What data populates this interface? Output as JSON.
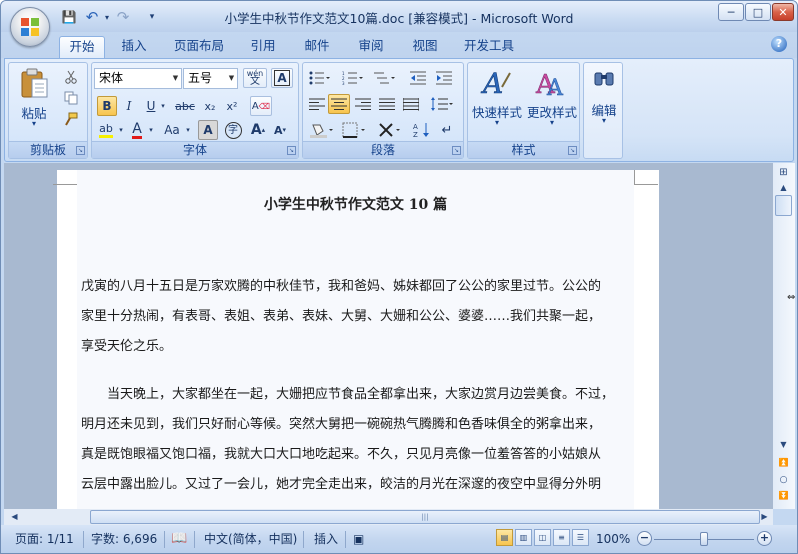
{
  "window": {
    "title": "小学生中秋节作文范文10篇.doc [兼容模式] - Microsoft Word",
    "minimize": "─",
    "maximize": "□",
    "close": "✕"
  },
  "quick_access": {
    "save": "💾",
    "undo": "↶",
    "redo": "↷",
    "customize": "▾"
  },
  "tabs": [
    "开始",
    "插入",
    "页面布局",
    "引用",
    "邮件",
    "审阅",
    "视图",
    "开发工具"
  ],
  "help_label": "?",
  "ribbon": {
    "clipboard": {
      "label": "剪贴板",
      "paste": "粘贴",
      "paste_arrow": "▾"
    },
    "font": {
      "label": "字体",
      "font_name": "宋体",
      "font_size": "五号",
      "bold": "B",
      "italic": "I",
      "underline": "U",
      "strike": "abc",
      "subscript": "x₂",
      "superscript": "x²",
      "grow": "A",
      "shrink": "A",
      "case": "Aa",
      "char_shade": "A",
      "enclose": "字",
      "clear": "A",
      "pinyin": "wén",
      "border_char": "A",
      "font_color": "A",
      "highlight": "ab"
    },
    "paragraph": {
      "label": "段落"
    },
    "styles": {
      "label": "样式",
      "quick_styles": "快速样式",
      "change_styles": "更改样式",
      "arrow": "▾"
    },
    "editing": {
      "label": "编辑",
      "arrow": "▾"
    }
  },
  "document": {
    "title": "小学生中秋节作文范文 10 篇",
    "paragraphs": [
      [
        "戊寅的八月十五日是万家欢腾的中秋佳节，我和爸妈、姊妹都回了公公的家里过节。公公的",
        "家里十分热闹，有表哥、表姐、表弟、表妹、大舅、大姗和公公、婆婆……我们共聚一起，",
        "享受天伦之乐。"
      ],
      [
        "当天晚上，大家都坐在一起，大姗把应节食品全都拿出来，大家边赏月边尝美食。不过，",
        "明月还未见到，我们只好耐心等候。突然大舅把一碗碗热气腾腾和色香味俱全的粥拿出来，",
        "真是既饱眼福又饱口福，我就大口大口地吃起来。不久，只见月亮像一位羞答答的小姑娘从",
        "云层中露出脸儿。又过了一会儿，她才完全走出来，皎洁的月光在深邃的夜空中显得分外明"
      ]
    ]
  },
  "statusbar": {
    "page": "页面: 1/11",
    "words": "字数: 6,696",
    "language": "中文(简体，中国)",
    "mode": "插入",
    "zoom": "100%",
    "zoom_minus": "−",
    "zoom_plus": "+",
    "zoom_value": 1.0
  },
  "colors": {
    "accent": "#15428b",
    "ribbon_bg": "#d5e4f7",
    "font_color_bar": "#e11a1a",
    "highlight_bar": "#f6f000"
  }
}
